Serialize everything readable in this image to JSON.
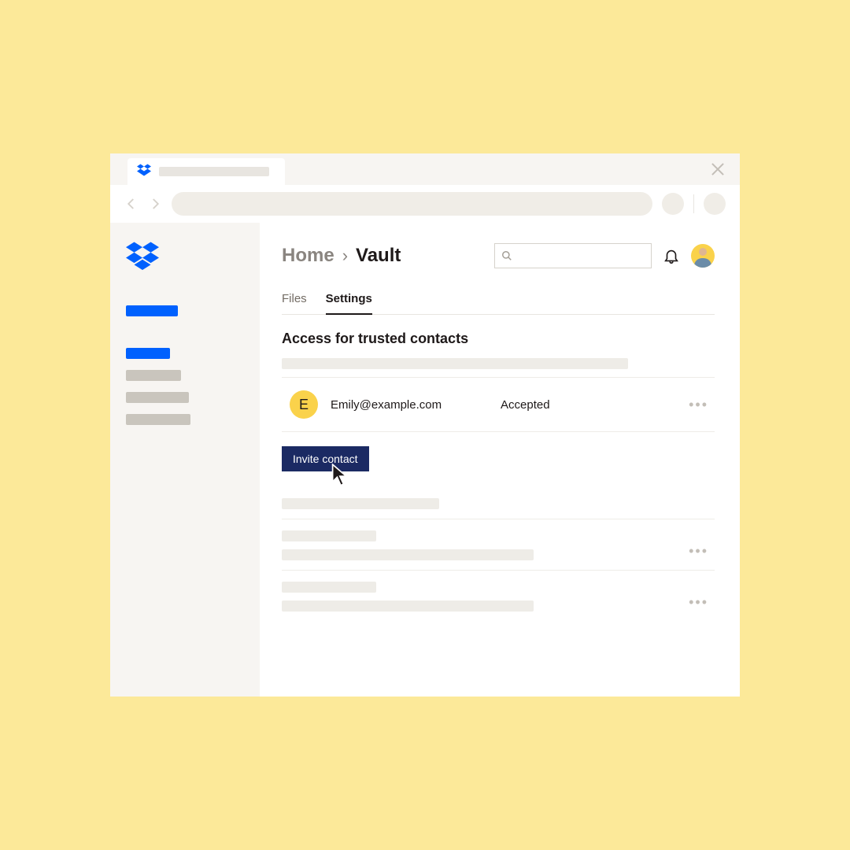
{
  "breadcrumb": {
    "home": "Home",
    "separator": "›",
    "current": "Vault"
  },
  "tabs": {
    "files": "Files",
    "settings": "Settings"
  },
  "section": {
    "title": "Access for trusted contacts"
  },
  "contact": {
    "initial": "E",
    "email": "Emily@example.com",
    "status": "Accepted"
  },
  "buttons": {
    "invite": "Invite contact"
  },
  "colors": {
    "accent_blue": "#0061fe",
    "brand_yellow": "#fad24b",
    "button_navy": "#1b2a63"
  }
}
